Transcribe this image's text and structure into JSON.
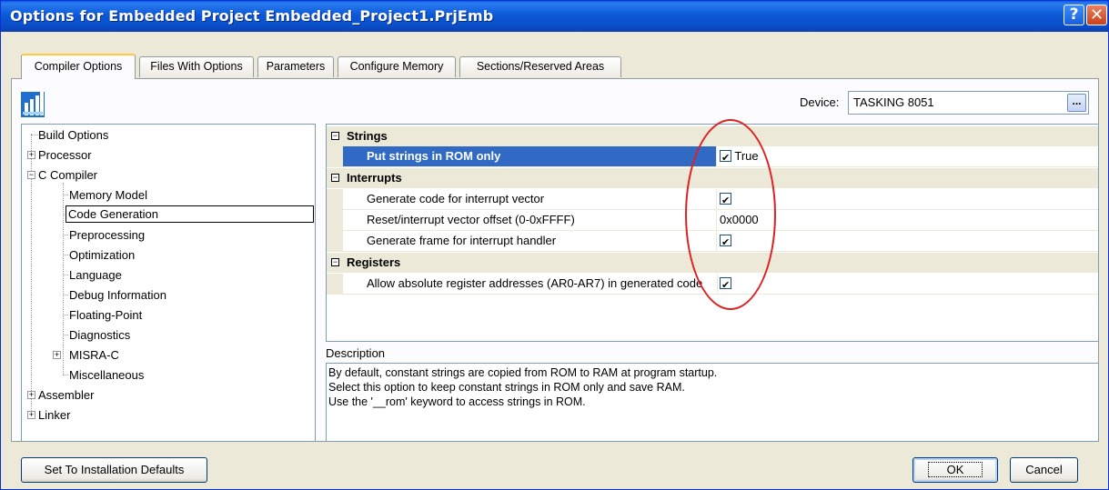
{
  "window": {
    "title": "Options for Embedded Project Embedded_Project1.PrjEmb",
    "help_glyph": "?",
    "close_glyph": "✕"
  },
  "tabs": [
    {
      "label": "Compiler Options",
      "active": true
    },
    {
      "label": "Files With Options",
      "active": false
    },
    {
      "label": "Parameters",
      "active": false
    },
    {
      "label": "Configure Memory",
      "active": false
    },
    {
      "label": "Sections/Reserved Areas",
      "active": false
    }
  ],
  "device": {
    "label": "Device:",
    "value": "TASKING 8051",
    "browse_label": "..."
  },
  "tree": {
    "expand_glyph": "+",
    "collapse_glyph": "−",
    "items": [
      {
        "label": "Build Options"
      },
      {
        "label": "Processor"
      },
      {
        "label": "C Compiler"
      },
      {
        "label": "Memory Model"
      },
      {
        "label": "Code Generation",
        "selected": true
      },
      {
        "label": "Preprocessing"
      },
      {
        "label": "Optimization"
      },
      {
        "label": "Language"
      },
      {
        "label": "Debug Information"
      },
      {
        "label": "Floating-Point"
      },
      {
        "label": "Diagnostics"
      },
      {
        "label": "MISRA-C"
      },
      {
        "label": "Miscellaneous"
      },
      {
        "label": "Assembler"
      },
      {
        "label": "Linker"
      }
    ]
  },
  "grid": {
    "collapse_glyph": "−",
    "categories": [
      {
        "label": "Strings",
        "props": [
          {
            "name": "Put strings in ROM only",
            "value": "True",
            "checked": true,
            "selected": true
          }
        ]
      },
      {
        "label": "Interrupts",
        "props": [
          {
            "name": "Generate code for interrupt vector",
            "value": "",
            "checked": true
          },
          {
            "name": "Reset/interrupt vector offset (0-0xFFFF)",
            "value": "0x0000",
            "checked": false
          },
          {
            "name": "Generate frame for interrupt handler",
            "value": "",
            "checked": true
          }
        ]
      },
      {
        "label": "Registers",
        "props": [
          {
            "name": "Allow absolute register addresses (AR0-AR7) in generated code",
            "value": "",
            "checked": true
          }
        ]
      }
    ]
  },
  "description": {
    "title": "Description",
    "lines": [
      "By default, constant strings are copied from ROM to RAM at program startup.",
      "Select this option to keep constant strings in ROM only and save RAM.",
      "Use the '__rom' keyword to access strings in ROM."
    ]
  },
  "buttons": {
    "defaults": "Set To Installation Defaults",
    "ok": "OK",
    "cancel": "Cancel"
  },
  "colors": {
    "selection": "#316ac5",
    "annotation": "#e02020",
    "titlebar": "#0a5fe0"
  }
}
